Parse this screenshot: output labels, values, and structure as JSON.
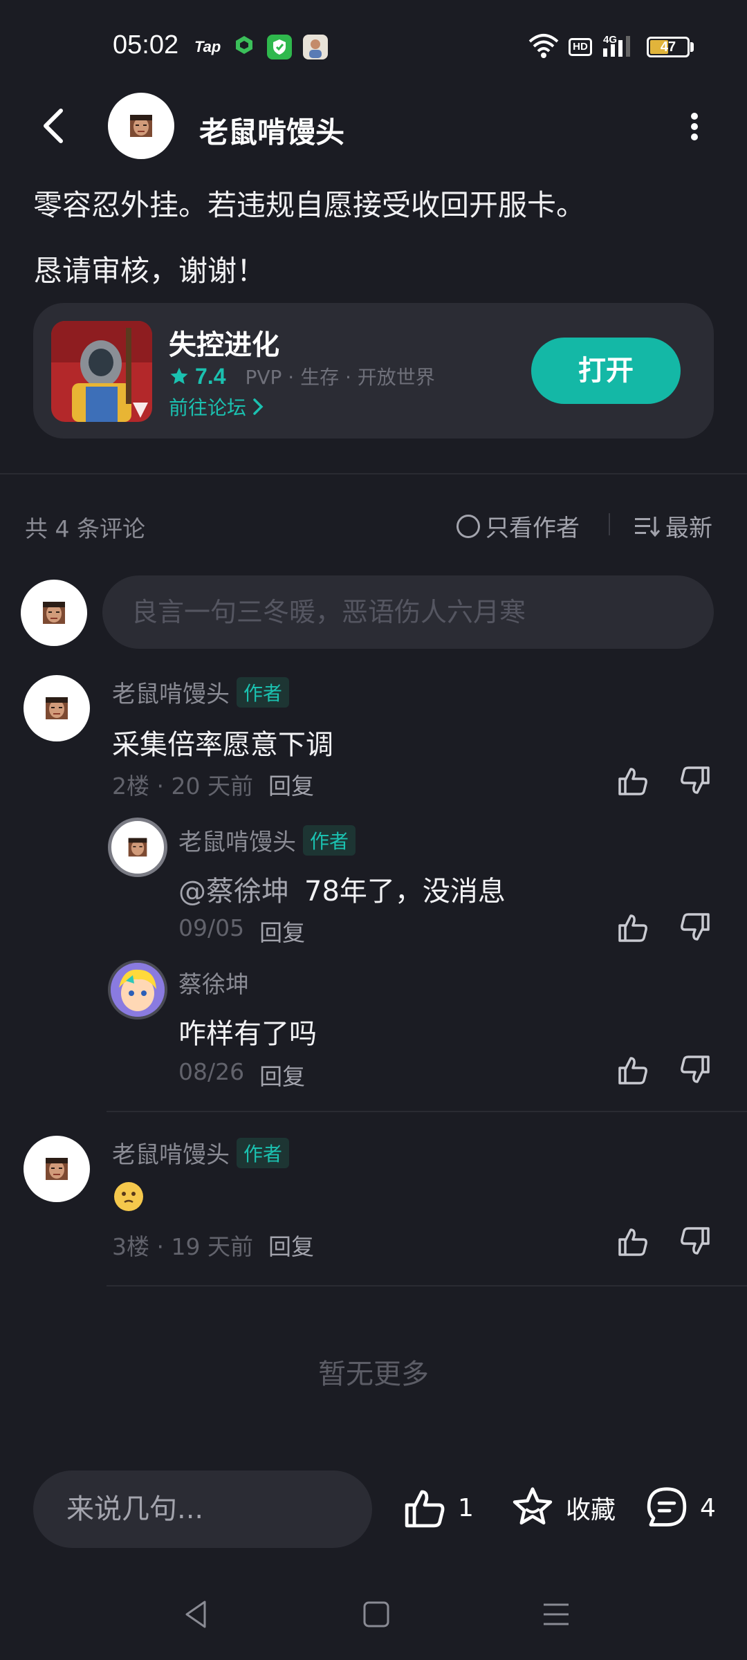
{
  "status_bar": {
    "time": "05:02",
    "tap_label": "Tap",
    "hd_label": "HD",
    "network_label": "4G",
    "battery": "47"
  },
  "header": {
    "username": "老鼠啃馒头"
  },
  "post": {
    "line1": "零容忍外挂。若违规自愿接受收回开服卡。",
    "line2": "恳请审核，谢谢！"
  },
  "game_card": {
    "name": "失控进化",
    "rating": "7.4",
    "tags": "PVP · 生存 · 开放世界",
    "forum_link": "前往论坛",
    "open_label": "打开",
    "accent_color": "#14b8a6"
  },
  "comments_header": {
    "count_text": "共 4 条评论",
    "author_only": "只看作者",
    "sort": "最新"
  },
  "comment_input": {
    "placeholder": "良言一句三冬暖，恶语伤人六月寒"
  },
  "comments": [
    {
      "name": "老鼠啃馒头",
      "badge": "作者",
      "text": "采集倍率愿意下调",
      "meta": "2楼 · 20 天前",
      "reply": "回复",
      "replies": [
        {
          "name": "老鼠啃馒头",
          "badge": "作者",
          "mention": "@蔡徐坤",
          "text": "78年了，没消息",
          "meta": "09/05",
          "reply": "回复"
        },
        {
          "name": "蔡徐坤",
          "text": "咋样有了吗",
          "meta": "08/26",
          "reply": "回复"
        }
      ]
    },
    {
      "name": "老鼠啃馒头",
      "badge": "作者",
      "text": "",
      "emoji": "face-emoji",
      "meta": "3楼 · 19 天前",
      "reply": "回复"
    }
  ],
  "no_more": "暂无更多",
  "bottom_bar": {
    "input_placeholder": "来说几句...",
    "like_count": "1",
    "favorite_label": "收藏",
    "comment_count": "4"
  },
  "icons": [
    "back-icon",
    "more-icon",
    "thumb-up-icon",
    "thumb-down-icon",
    "star-icon",
    "chat-icon",
    "nav-back-icon",
    "nav-home-icon",
    "nav-menu-icon"
  ]
}
